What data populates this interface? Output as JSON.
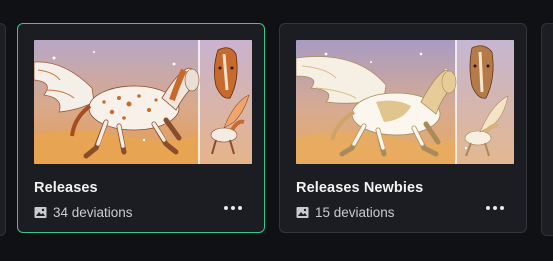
{
  "collections": [
    {
      "title": "Releases",
      "count_text": "34 deviations",
      "selected": true,
      "thumbnail": {
        "subject": "appaloosa winged horse with portrait and foal",
        "bg_top": "#b9a9c4",
        "bg_bottom": "#e8a35a",
        "coat": "#c96a2c"
      }
    },
    {
      "title": "Releases Newbies",
      "count_text": "15 deviations",
      "selected": false,
      "thumbnail": {
        "subject": "palomino pinto winged horse with portrait and foal",
        "bg_top": "#a99cc2",
        "bg_bottom": "#e6ad6a",
        "coat": "#e0c58d"
      }
    }
  ],
  "icons": {
    "gallery": "image-icon",
    "more": "more-horizontal-icon"
  },
  "colors": {
    "page_bg": "#0f1115",
    "card_bg": "#1b1d22",
    "selected_border": "#35c989"
  }
}
